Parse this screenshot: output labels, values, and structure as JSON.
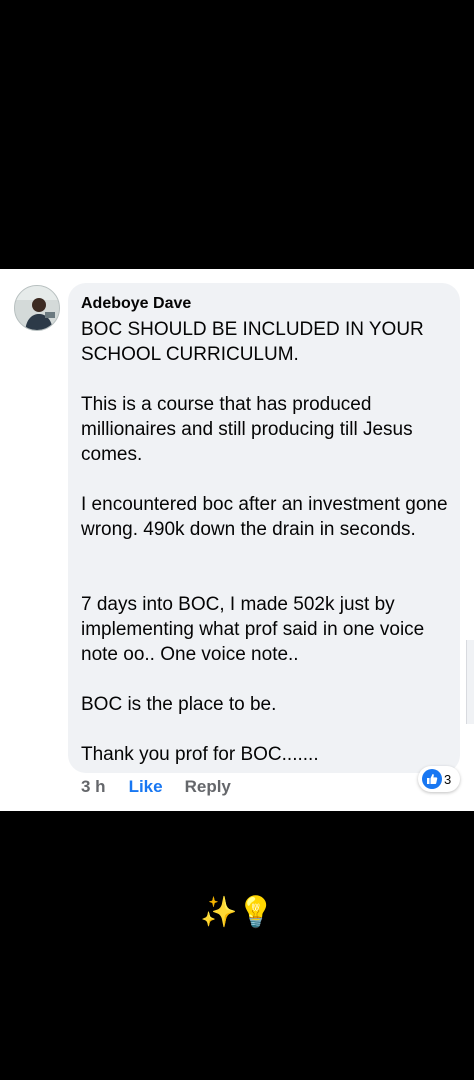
{
  "comment": {
    "author": "Adeboye Dave",
    "paragraphs": [
      "BOC SHOULD BE INCLUDED IN YOUR SCHOOL CURRICULUM.",
      "This is a course that has produced millionaires and still producing till Jesus comes.",
      "I encountered boc after an investment gone wrong. 490k down the drain in seconds.",
      "7 days into BOC, I made 502k just by implementing what prof said in one voice note oo.. One voice note..",
      "BOC is the place to be.",
      "Thank you prof for BOC......."
    ],
    "time": "3 h",
    "like_label": "Like",
    "reply_label": "Reply",
    "reaction": {
      "icon": "thumbs-up-icon",
      "count": "3",
      "color": "#1877f2"
    }
  },
  "caption": {
    "emojis": [
      "✨",
      "💡"
    ]
  },
  "colors": {
    "background": "#000000",
    "card": "#ffffff",
    "bubble": "#f0f2f5",
    "link": "#1877f2",
    "meta": "#65676b"
  }
}
